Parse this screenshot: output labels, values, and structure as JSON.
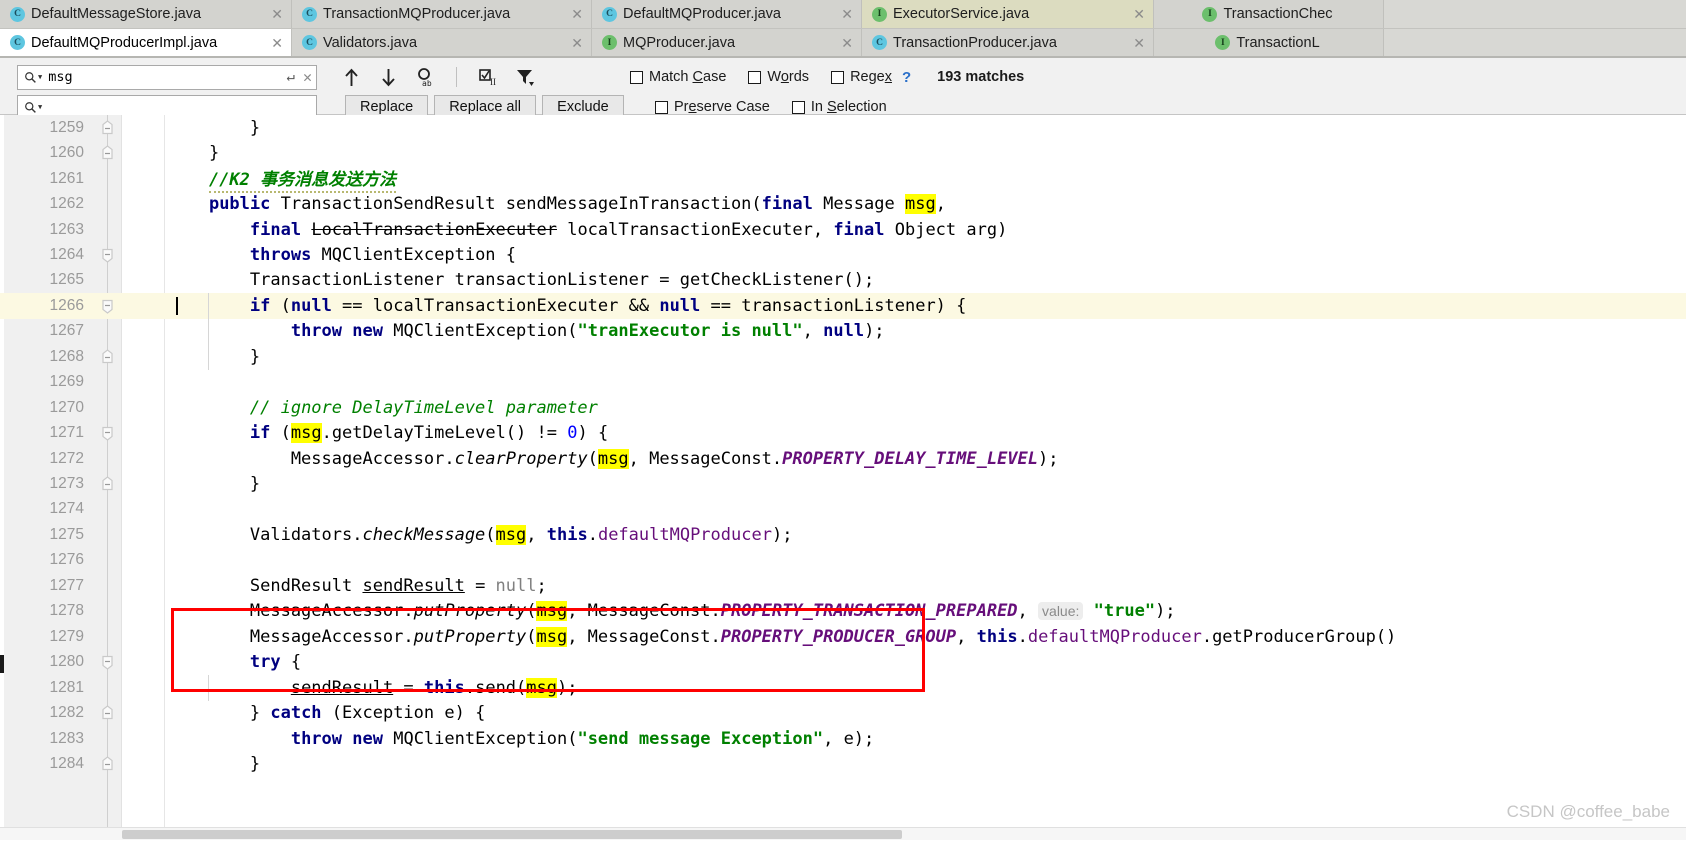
{
  "tabs_row1": [
    {
      "label": "DefaultMessageStore.java",
      "icon": "java-class-icon",
      "state": "plain",
      "width": "w1"
    },
    {
      "label": "TransactionMQProducer.java",
      "icon": "java-class-icon",
      "state": "plain",
      "width": "w2"
    },
    {
      "label": "DefaultMQProducer.java",
      "icon": "java-class-icon",
      "state": "plain",
      "width": "w3"
    },
    {
      "label": "ExecutorService.java",
      "icon": "java-interface-icon",
      "state": "active-olive",
      "width": "w4"
    },
    {
      "label": "TransactionChec",
      "icon": "java-interface-icon",
      "state": "plain",
      "width": "w7"
    }
  ],
  "tabs_row2": [
    {
      "label": "DefaultMQProducerImpl.java",
      "icon": "java-class-icon",
      "state": "active-light",
      "width": "w1"
    },
    {
      "label": "Validators.java",
      "icon": "java-class-icon",
      "state": "plain",
      "width": "w2"
    },
    {
      "label": "MQProducer.java",
      "icon": "java-interface-icon",
      "state": "plain",
      "width": "w3"
    },
    {
      "label": "TransactionProducer.java",
      "icon": "java-class-icon",
      "state": "plain",
      "width": "w4"
    },
    {
      "label": "TransactionL",
      "icon": "java-interface-icon",
      "state": "plain",
      "width": "w7"
    }
  ],
  "find": {
    "search_value": "msg",
    "search_placeholder": "",
    "replace_value": "",
    "replace_placeholder": "",
    "buttons": {
      "replace": "Replace",
      "replace_all": "Replace all",
      "exclude": "Exclude"
    },
    "options": [
      {
        "id": "match-case",
        "label_pre": "Match ",
        "label_mnemonic": "C",
        "label_post": "ase",
        "checked": false
      },
      {
        "id": "words",
        "label_pre": "W",
        "label_mnemonic": "o",
        "label_post": "rds",
        "checked": false
      },
      {
        "id": "regex",
        "label_pre": "Rege",
        "label_mnemonic": "x",
        "label_post": "",
        "checked": false
      },
      {
        "id": "preserve-case",
        "label_pre": "Pr",
        "label_mnemonic": "e",
        "label_post": "serve Case",
        "checked": false
      },
      {
        "id": "in-selection",
        "label_pre": "In ",
        "label_mnemonic": "S",
        "label_post": "election",
        "checked": false
      }
    ],
    "help_glyph": "?",
    "match_count": "193 matches"
  },
  "editor": {
    "caret_line": 1266,
    "first_line": 1259,
    "highlight_term": "msg",
    "highlight_color": "#ffff00",
    "annotation_box_color": "#ff0000",
    "lines": [
      {
        "n": 1259,
        "fold": "end"
      },
      {
        "n": 1260,
        "fold": "end"
      },
      {
        "n": 1261,
        "fold": "none"
      },
      {
        "n": 1262,
        "fold": "none"
      },
      {
        "n": 1263,
        "fold": "none"
      },
      {
        "n": 1264,
        "fold": "start"
      },
      {
        "n": 1265,
        "fold": "none"
      },
      {
        "n": 1266,
        "fold": "start"
      },
      {
        "n": 1267,
        "fold": "none"
      },
      {
        "n": 1268,
        "fold": "end"
      },
      {
        "n": 1269,
        "fold": "none"
      },
      {
        "n": 1270,
        "fold": "none"
      },
      {
        "n": 1271,
        "fold": "start"
      },
      {
        "n": 1272,
        "fold": "none"
      },
      {
        "n": 1273,
        "fold": "end"
      },
      {
        "n": 1274,
        "fold": "none"
      },
      {
        "n": 1275,
        "fold": "none"
      },
      {
        "n": 1276,
        "fold": "none"
      },
      {
        "n": 1277,
        "fold": "none"
      },
      {
        "n": 1278,
        "fold": "none"
      },
      {
        "n": 1279,
        "fold": "none"
      },
      {
        "n": 1280,
        "fold": "start"
      },
      {
        "n": 1281,
        "fold": "none"
      },
      {
        "n": 1282,
        "fold": "end"
      },
      {
        "n": 1283,
        "fold": "none"
      },
      {
        "n": 1284,
        "fold": "end"
      }
    ],
    "code_text": [
      "        }",
      "    }",
      "    //K2 事务消息发送方法",
      "    public TransactionSendResult sendMessageInTransaction(final Message msg,",
      "        final LocalTransactionExecuter localTransactionExecuter, final Object arg)",
      "        throws MQClientException {",
      "        TransactionListener transactionListener = getCheckListener();",
      "        if (null == localTransactionExecuter && null == transactionListener) {",
      "            throw new MQClientException(\"tranExecutor is null\", null);",
      "        }",
      "",
      "        // ignore DelayTimeLevel parameter",
      "        if (msg.getDelayTimeLevel() != 0) {",
      "            MessageAccessor.clearProperty(msg, MessageConst.PROPERTY_DELAY_TIME_LEVEL);",
      "        }",
      "",
      "        Validators.checkMessage(msg, this.defaultMQProducer);",
      "",
      "        SendResult sendResult = null;",
      "        MessageAccessor.putProperty(msg, MessageConst.PROPERTY_TRANSACTION_PREPARED, value: \"true\");",
      "        MessageAccessor.putProperty(msg, MessageConst.PROPERTY_PRODUCER_GROUP, this.defaultMQProducer.getProducerGroup()",
      "        try {",
      "            sendResult = this.send(msg);",
      "        } catch (Exception e) {",
      "            throw new MQClientException(\"send message Exception\", e);",
      "        }"
    ],
    "inlay_hints": [
      "value:"
    ]
  },
  "watermark": "CSDN @coffee_babe"
}
